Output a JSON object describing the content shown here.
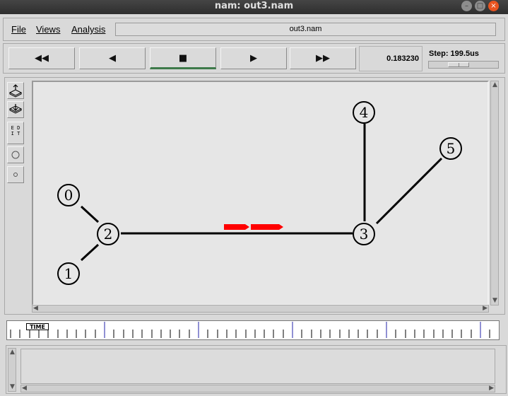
{
  "window": {
    "title": "nam: out3.nam"
  },
  "menu": {
    "file": "File",
    "views": "Views",
    "analysis": "Analysis",
    "filename": "out3.nam"
  },
  "controls": {
    "rewind": "◀◀",
    "back": "◀",
    "stop": "■",
    "play": "▶",
    "fastforward": "▶▶",
    "time": "0.183230",
    "step_label": "Step: 199.5us"
  },
  "tools": {
    "edit": "EDIT"
  },
  "nodes": [
    {
      "id": "0"
    },
    {
      "id": "1"
    },
    {
      "id": "2"
    },
    {
      "id": "3"
    },
    {
      "id": "4"
    },
    {
      "id": "5"
    }
  ],
  "timeline": {
    "label": "TIME"
  },
  "colors": {
    "packet": "#ff0000",
    "link": "#000000",
    "canvas": "#e6e6e6",
    "active_indicator": "#3e7a4a",
    "close": "#e95420"
  },
  "icons": [
    "zoom-in-icon",
    "zoom-out-icon",
    "edit-icon",
    "circle-large-icon",
    "circle-small-icon"
  ]
}
